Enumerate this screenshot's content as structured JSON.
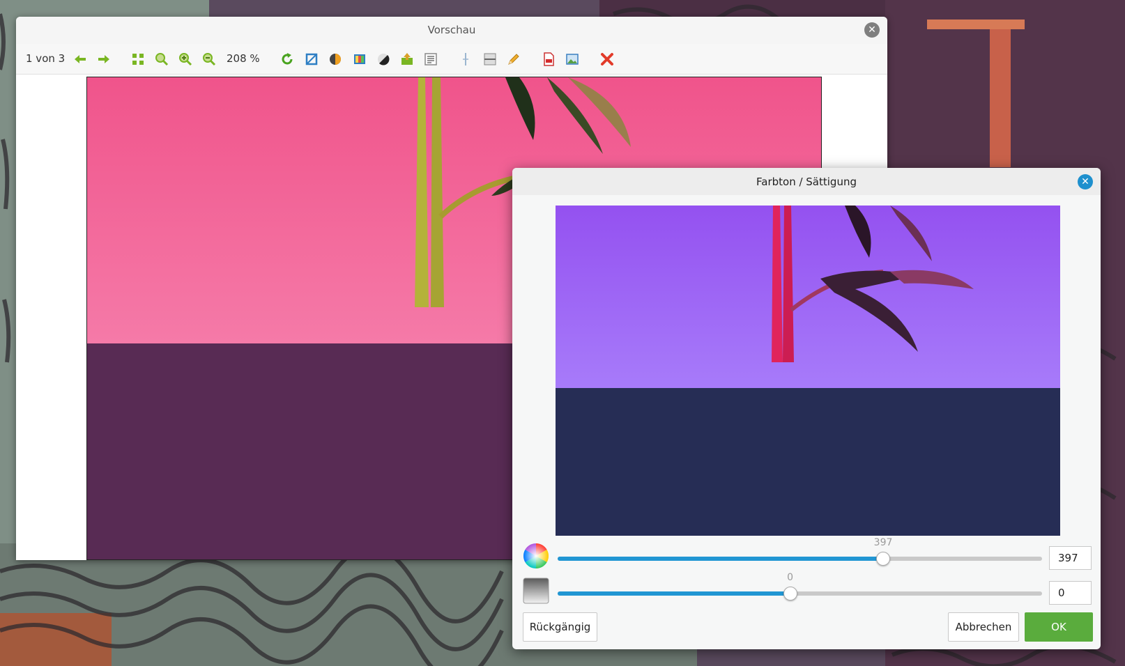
{
  "preview_window": {
    "title": "Vorschau",
    "page_indicator": "1 von 3",
    "zoom": "208 %",
    "toolbar_icons": [
      "arrow-left-icon",
      "arrow-right-icon",
      "fit-grid-icon",
      "zoom-fit-icon",
      "zoom-in-icon",
      "zoom-out-icon",
      "rotate-icon",
      "crop-icon",
      "brightness-contrast-icon",
      "color-palette-icon",
      "invert-icon",
      "adjust-image-icon",
      "text-settings-icon",
      "vertical-split-icon",
      "horizontal-split-icon",
      "pencil-icon",
      "pdf-icon",
      "image-icon",
      "delete-icon"
    ],
    "image_colors": {
      "top": "#f57aa8",
      "top_upper": "#f0548b",
      "bottom": "#582b54",
      "stem": "#b4b23a"
    }
  },
  "hue_dialog": {
    "title": "Farbton / Sättigung",
    "hue": {
      "value": "397",
      "input": "397",
      "fraction": 0.672
    },
    "saturation": {
      "value": "0",
      "input": "0",
      "fraction": 0.48
    },
    "buttons": {
      "undo": "Rückgängig",
      "cancel": "Abbrechen",
      "ok": "OK"
    },
    "image_colors": {
      "top": "#a77bfa",
      "top_upper": "#9451f0",
      "bottom": "#262d55",
      "stem": "#e0245c"
    }
  },
  "colors": {
    "accent": "#2196d3",
    "ok_green": "#5aac3d",
    "close_grey": "#7f7f7f"
  }
}
